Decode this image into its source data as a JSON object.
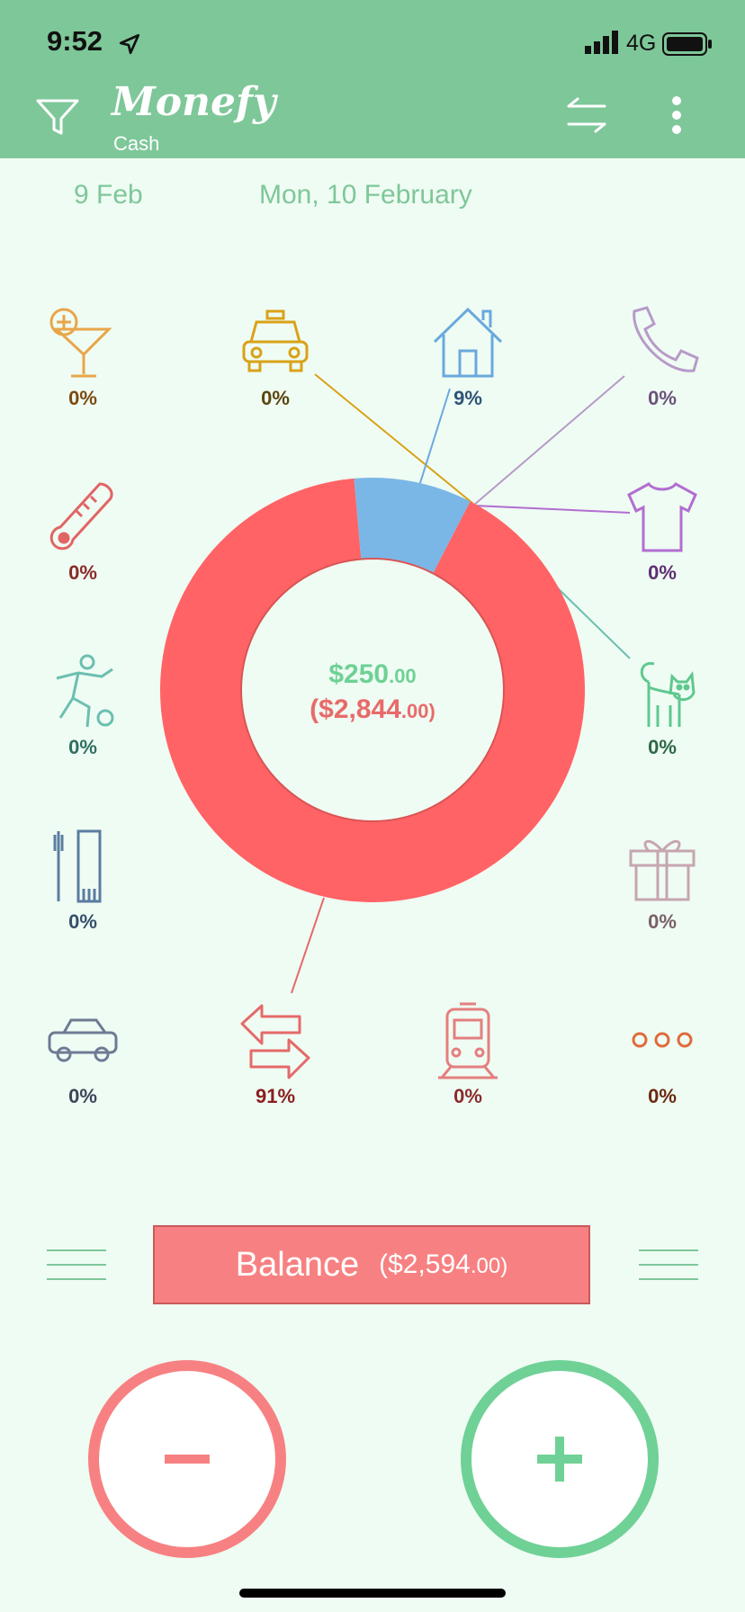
{
  "status_bar": {
    "time": "9:52",
    "network": "4G"
  },
  "header": {
    "title": "Monefy",
    "account": "Cash"
  },
  "dates": {
    "previous": "9 Feb",
    "current": "Mon, 10 February"
  },
  "categories": [
    {
      "name": "cocktail-icon",
      "percent": "0%",
      "color": "#e8a64a"
    },
    {
      "name": "taxi-icon",
      "percent": "0%",
      "color": "#d9a219"
    },
    {
      "name": "house-icon",
      "percent": "9%",
      "color": "#6aa9dd"
    },
    {
      "name": "phone-icon",
      "percent": "0%",
      "color": "#b79ac9"
    },
    {
      "name": "thermometer-icon",
      "percent": "0%",
      "color": "#e16565"
    },
    {
      "name": "tshirt-icon",
      "percent": "0%",
      "color": "#b26ed0"
    },
    {
      "name": "soccer-player-icon",
      "percent": "0%",
      "color": "#6bbfb0"
    },
    {
      "name": "cat-icon",
      "percent": "0%",
      "color": "#5fc88f"
    },
    {
      "name": "toothbrush-icon",
      "percent": "0%",
      "color": "#5b7ca0"
    },
    {
      "name": "gift-icon",
      "percent": "0%",
      "color": "#c6a6b0"
    },
    {
      "name": "car-icon",
      "percent": "0%",
      "color": "#6f7a94"
    },
    {
      "name": "transfer-icon",
      "percent": "91%",
      "color": "#e46a6a"
    },
    {
      "name": "train-icon",
      "percent": "0%",
      "color": "#e47f7f"
    },
    {
      "name": "more-icon",
      "percent": "0%",
      "color": "#e06a3a"
    }
  ],
  "chart_data": {
    "type": "pie",
    "slices": [
      {
        "label": "house",
        "value": 9,
        "color": "#7bb7e6"
      },
      {
        "label": "transfer",
        "value": 91,
        "color": "#ff6366"
      }
    ]
  },
  "summary": {
    "income_main": "$250",
    "income_cents": ".00",
    "expense_main": "($2,844",
    "expense_cents": ".00)"
  },
  "balance": {
    "label": "Balance",
    "amount_main": "($2,594",
    "amount_cents": ".00)"
  },
  "colors": {
    "header": "#7ec799",
    "expense": "#f78182",
    "income": "#6fd196",
    "background": "#effcf3"
  }
}
